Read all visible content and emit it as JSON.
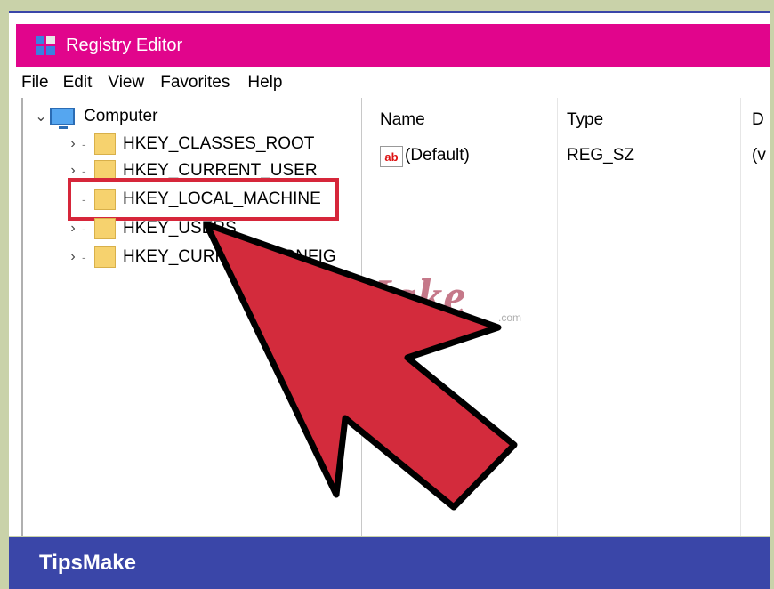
{
  "window": {
    "title": "Registry Editor",
    "titlebar_color": "#e1058c"
  },
  "menu": [
    "File",
    "Edit",
    "View",
    "Favorites",
    "Help"
  ],
  "tree": {
    "root": "Computer",
    "items": [
      {
        "label": "HKEY_CLASSES_ROOT"
      },
      {
        "label": "HKEY_CURRENT_USER"
      },
      {
        "label": "HKEY_LOCAL_MACHINE",
        "selected": true
      },
      {
        "label": "HKEY_USERS"
      },
      {
        "label": "HKEY_CURRENT_CONFIG"
      }
    ]
  },
  "list": {
    "columns": [
      "Name",
      "Type",
      "D"
    ],
    "rows": [
      {
        "name": "(Default)",
        "type": "REG_SZ",
        "data": "(v"
      }
    ]
  },
  "icons": {
    "value_icon": "ab"
  },
  "watermark": {
    "text": "TipsMake",
    "suffix": ".com"
  },
  "footer": {
    "brand": "TipsMake",
    "color": "#3a46a8"
  },
  "highlight_color": "#d6263a"
}
